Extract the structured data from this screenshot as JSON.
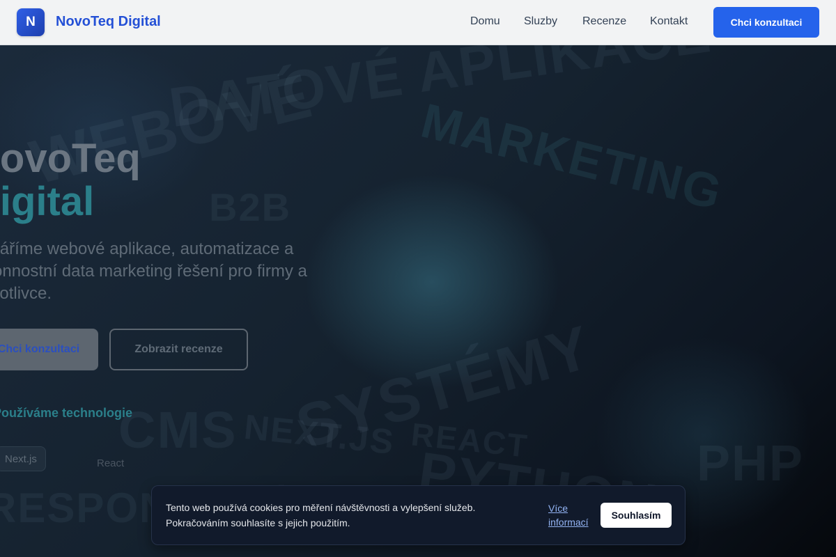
{
  "header": {
    "logo_letter": "N",
    "brand": "NovoTeq Digital",
    "nav": [
      "Domu",
      "Sluzby",
      "Recenze",
      "Kontakt"
    ],
    "cta": "Chci konzultaci"
  },
  "hero": {
    "title_line1": "NovoTeq",
    "title_line2": "Digital",
    "subtitle": "Vytváříme webové aplikace, automatizace a výkonnostní data marketing řešení pro firmy a jednotlivce.",
    "primary_button": "Chci konzultaci",
    "secondary_button": "Zobrazit recenze",
    "tech_heading": "Používáme technologie",
    "tech_chips": [
      "Next.js",
      "React"
    ]
  },
  "background_words": [
    "DATOVÉ APLIKACE",
    "WEBOVÉ",
    "MARKETING",
    "B2B",
    "SYSTÉMY",
    "CMS",
    "NEXT.JS",
    "REACT",
    "PYTHON",
    "PHP",
    "RESPONZIVNÍ"
  ],
  "cookie": {
    "text": "Tento web používá cookies pro měření návštěvnosti a vylepšení služeb. Pokračováním souhlasíte s jejich použitím.",
    "more_link": "Více informací",
    "accept": "Souhlasím"
  },
  "colors": {
    "accent": "#2563eb",
    "brand_text": "#2450d6",
    "hero_accent": "#2b7f8a"
  }
}
